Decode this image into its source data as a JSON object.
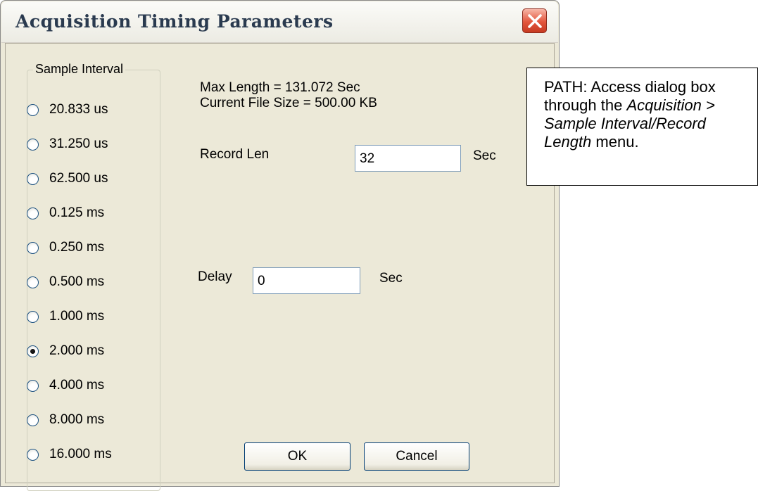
{
  "dialog": {
    "title": "Acquisition Timing Parameters",
    "close_icon": "close-icon",
    "accent_color": "#e3563c"
  },
  "sample_interval": {
    "label": "Sample Interval",
    "options": [
      {
        "label": "20.833 us",
        "checked": false
      },
      {
        "label": "31.250 us",
        "checked": false
      },
      {
        "label": "62.500 us",
        "checked": false
      },
      {
        "label": "0.125 ms",
        "checked": false
      },
      {
        "label": "0.250 ms",
        "checked": false
      },
      {
        "label": "0.500 ms",
        "checked": false
      },
      {
        "label": "1.000 ms",
        "checked": false
      },
      {
        "label": "2.000 ms",
        "checked": true
      },
      {
        "label": "4.000 ms",
        "checked": false
      },
      {
        "label": "8.000 ms",
        "checked": false
      },
      {
        "label": "16.000 ms",
        "checked": false
      }
    ]
  },
  "info": {
    "max_length": "Max Length = 131.072 Sec",
    "file_size": "Current File Size = 500.00 KB"
  },
  "record_len": {
    "label": "Record Len",
    "value": "32",
    "unit": "Sec"
  },
  "delay": {
    "label": "Delay",
    "value": "0",
    "unit": "Sec"
  },
  "buttons": {
    "ok": "OK",
    "cancel": "Cancel"
  },
  "callout": {
    "line1": "PATH: Access dialog box through the",
    "menu_path": "Acquisition > Sample Interval/Record Length",
    "line3": "menu."
  }
}
